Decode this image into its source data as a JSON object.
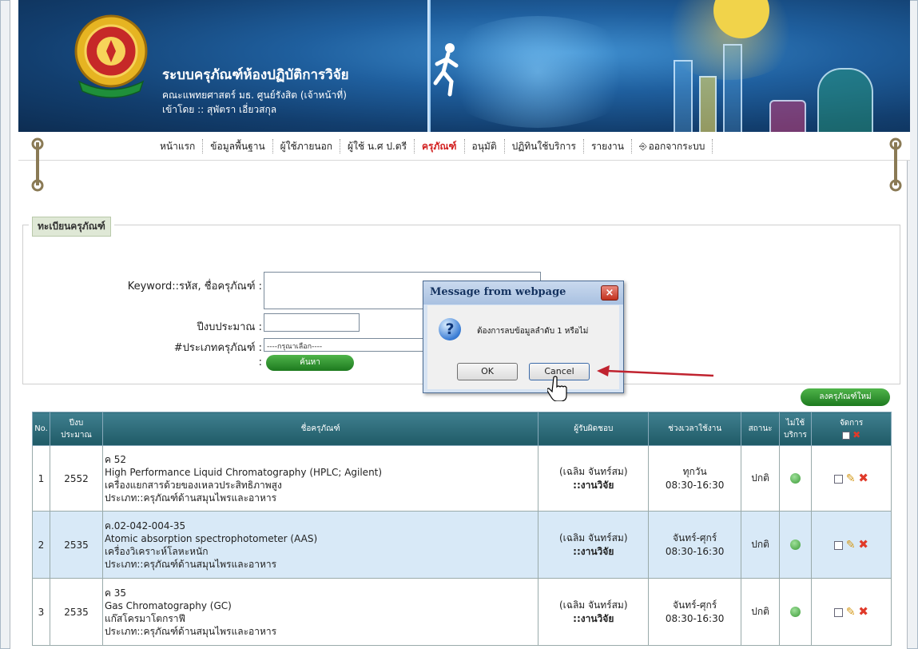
{
  "header": {
    "title": "ระบบครุภัณฑ์ห้องปฏิบัติการวิจัย",
    "faculty": "คณะแพทยศาสตร์ มธ. ศูนย์รังสิต (เจ้าหน้าที่)",
    "login": "เข้าโดย :: สุพัตรา เอี่ยวสกุล"
  },
  "nav": {
    "items": [
      "หน้าแรก",
      "ข้อมูลพื้นฐาน",
      "ผู้ใช้ภายนอก",
      "ผู้ใช้ น.ศ ป.ตรี",
      "ครุภัณฑ์",
      "อนุมัติ",
      "ปฏิทินใช้บริการ",
      "รายงาน",
      "ออกจากระบบ"
    ],
    "active": "ครุภัณฑ์"
  },
  "search": {
    "section_title": "ทะเบียนครุภัณฑ์",
    "keyword_label": "Keyword::รหัส, ชื่อครุภัณฑ์ :",
    "year_label": "ปีงบประมาณ :",
    "type_label": "#ประเภทครุภัณฑ์ :",
    "type_selected": "----กรุณาเลือก----",
    "colon": ":",
    "search_button": "ค้นหา"
  },
  "table": {
    "add_button": "ลงครุภัณฑ์ใหม่",
    "headers": {
      "no": "No.",
      "year_line1": "ปีงบ",
      "year_line2": "ประมาณ",
      "name": "ชื่อครุภัณฑ์",
      "responsible": "ผู้รับผิดชอบ",
      "time": "ช่วงเวลาใช้งาน",
      "status": "สถานะ",
      "service_line1": "ไม่ใช้",
      "service_line2": "บริการ",
      "manage": "จัดการ"
    },
    "rows": [
      {
        "no": "1",
        "year": "2552",
        "code": "ค 52",
        "name_en": "High Performance Liquid Chromatography (HPLC; Agilent)",
        "name_th": "เครื่องแยกสารด้วยของเหลวประสิทธิภาพสูง",
        "category": "ประเภท::ครุภัณฑ์ด้านสมุนไพรและอาหาร",
        "person": "(เฉลิม จันทร์สม)",
        "unit": "::งานวิจัย",
        "days": "ทุกวัน",
        "hours": "08:30-16:30",
        "status": "ปกติ"
      },
      {
        "no": "2",
        "year": "2535",
        "code": "ค.02-042-004-35",
        "name_en": "Atomic absorption spectrophotometer (AAS)",
        "name_th": "เครื่องวิเคราะห์โลหะหนัก",
        "category": "ประเภท::ครุภัณฑ์ด้านสมุนไพรและอาหาร",
        "person": "(เฉลิม จันทร์สม)",
        "unit": "::งานวิจัย",
        "days": "จันทร์-ศุกร์",
        "hours": "08:30-16:30",
        "status": "ปกติ"
      },
      {
        "no": "3",
        "year": "2535",
        "code": "ค 35",
        "name_en": "Gas Chromatography (GC)",
        "name_th": "แก๊สโครมาโตกราฟี",
        "category": "ประเภท::ครุภัณฑ์ด้านสมุนไพรและอาหาร",
        "person": "(เฉลิม จันทร์สม)",
        "unit": "::งานวิจัย",
        "days": "จันทร์-ศุกร์",
        "hours": "08:30-16:30",
        "status": "ปกติ"
      }
    ]
  },
  "dialog": {
    "title": "Message from webpage",
    "message": "ต้องการลบข้อมูลลำดับ 1 หรือไม่",
    "ok": "OK",
    "cancel": "Cancel",
    "close": "×"
  },
  "colors": {
    "accent_red": "#d21f1f",
    "header_teal": "#1f5a66",
    "row_alt": "#d8e9f7",
    "green_button": "#2f8f2c"
  }
}
